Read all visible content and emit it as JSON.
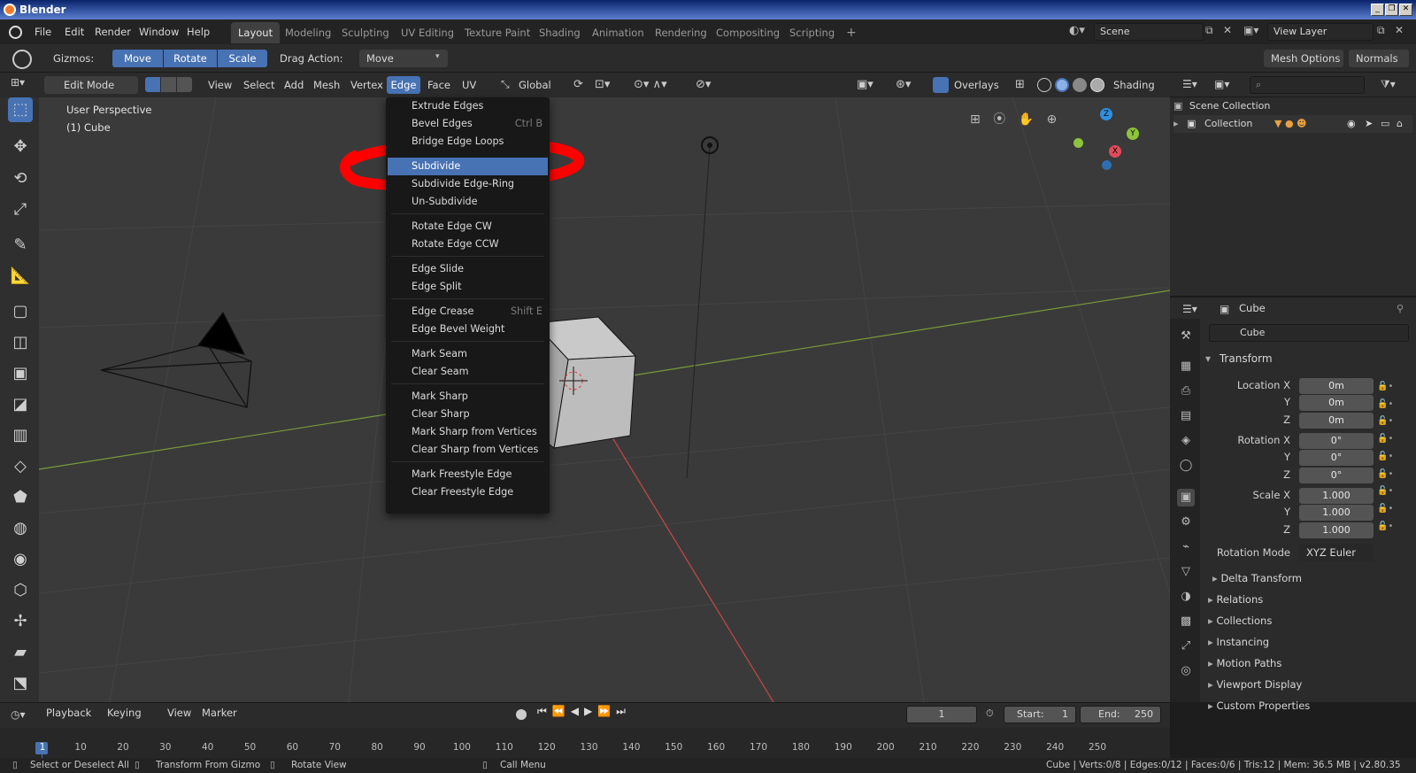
{
  "window": {
    "title": "Blender",
    "buttons": [
      "_",
      "❐",
      "✕"
    ]
  },
  "topbar": {
    "menus": [
      "File",
      "Edit",
      "Render",
      "Window",
      "Help"
    ],
    "workspaces": [
      "Layout",
      "Modeling",
      "Sculpting",
      "UV Editing",
      "Texture Paint",
      "Shading",
      "Animation",
      "Rendering",
      "Compositing",
      "Scripting"
    ],
    "add_tab": "+",
    "scene": "Scene",
    "view_layer": "View Layer"
  },
  "toolsettings": {
    "gizmos_label": "Gizmos:",
    "gizmo_buttons": [
      "Move",
      "Rotate",
      "Scale"
    ],
    "drag_action_label": "Drag Action:",
    "drag_action_value": "Move",
    "mesh_options": "Mesh Options",
    "normals": "Normals"
  },
  "viewport_header": {
    "mode": "Edit Mode",
    "menus": [
      "View",
      "Select",
      "Add",
      "Mesh",
      "Vertex",
      "Edge",
      "Face",
      "UV"
    ],
    "orientation": "Global",
    "overlays": "Overlays",
    "shading": "Shading"
  },
  "viewport": {
    "perspective": "User Perspective",
    "object": "(1) Cube",
    "axes": {
      "x": "X",
      "y": "Y",
      "z": "Z"
    }
  },
  "edge_menu": {
    "items": [
      {
        "label": "Extrude Edges",
        "shortcut": ""
      },
      {
        "label": "Bevel Edges",
        "shortcut": "Ctrl B"
      },
      {
        "label": "Bridge Edge Loops",
        "shortcut": ""
      },
      {
        "label": "Subdivide",
        "shortcut": ""
      },
      {
        "label": "Subdivide Edge-Ring",
        "shortcut": ""
      },
      {
        "label": "Un-Subdivide",
        "shortcut": ""
      },
      {
        "label": "Rotate Edge CW",
        "shortcut": ""
      },
      {
        "label": "Rotate Edge CCW",
        "shortcut": ""
      },
      {
        "label": "Edge Slide",
        "shortcut": ""
      },
      {
        "label": "Edge Split",
        "shortcut": ""
      },
      {
        "label": "Edge Crease",
        "shortcut": "Shift E"
      },
      {
        "label": "Edge Bevel Weight",
        "shortcut": ""
      },
      {
        "label": "Mark Seam",
        "shortcut": ""
      },
      {
        "label": "Clear Seam",
        "shortcut": ""
      },
      {
        "label": "Mark Sharp",
        "shortcut": ""
      },
      {
        "label": "Clear Sharp",
        "shortcut": ""
      },
      {
        "label": "Mark Sharp from Vertices",
        "shortcut": ""
      },
      {
        "label": "Clear Sharp from Vertices",
        "shortcut": ""
      },
      {
        "label": "Mark Freestyle Edge",
        "shortcut": ""
      },
      {
        "label": "Clear Freestyle Edge",
        "shortcut": ""
      }
    ],
    "highlighted": "Subdivide",
    "annotation_color": "#ff0000"
  },
  "outliner": {
    "scene_collection": "Scene Collection",
    "collection": "Collection"
  },
  "properties": {
    "object_name": "Cube",
    "datablock": "Cube",
    "transform_title": "Transform",
    "location_x_label": "Location X",
    "rotation_x_label": "Rotation X",
    "scale_x_label": "Scale X",
    "y_label": "Y",
    "z_label": "Z",
    "location": [
      "0m",
      "0m",
      "0m"
    ],
    "rotation": [
      "0°",
      "0°",
      "0°"
    ],
    "scale": [
      "1.000",
      "1.000",
      "1.000"
    ],
    "rotation_mode_label": "Rotation Mode",
    "rotation_mode": "XYZ Euler",
    "delta_transform": "Delta Transform",
    "panels": [
      "Relations",
      "Collections",
      "Instancing",
      "Motion Paths",
      "Viewport Display",
      "Custom Properties"
    ]
  },
  "timeline": {
    "menus": [
      "Playback",
      "Keying",
      "View",
      "Marker"
    ],
    "current_frame": "1",
    "start_label": "Start:",
    "start": "1",
    "end_label": "End:",
    "end": "250",
    "ticks": [
      "1",
      "10",
      "20",
      "30",
      "40",
      "50",
      "60",
      "70",
      "80",
      "90",
      "100",
      "110",
      "120",
      "130",
      "140",
      "150",
      "160",
      "170",
      "180",
      "190",
      "200",
      "210",
      "220",
      "230",
      "240",
      "250"
    ]
  },
  "statusbar": {
    "select": "Select or Deselect All",
    "transform": "Transform From Gizmo",
    "rotate": "Rotate View",
    "call_menu": "Call Menu",
    "stats": "Cube | Verts:0/8 | Edges:0/12 | Faces:0/6 | Tris:12 | Mem: 36.5 MB | v2.80.35"
  },
  "colors": {
    "accent": "#4772b3",
    "annotation": "#ff0000",
    "viewport_bg": "#3a3a3a"
  }
}
